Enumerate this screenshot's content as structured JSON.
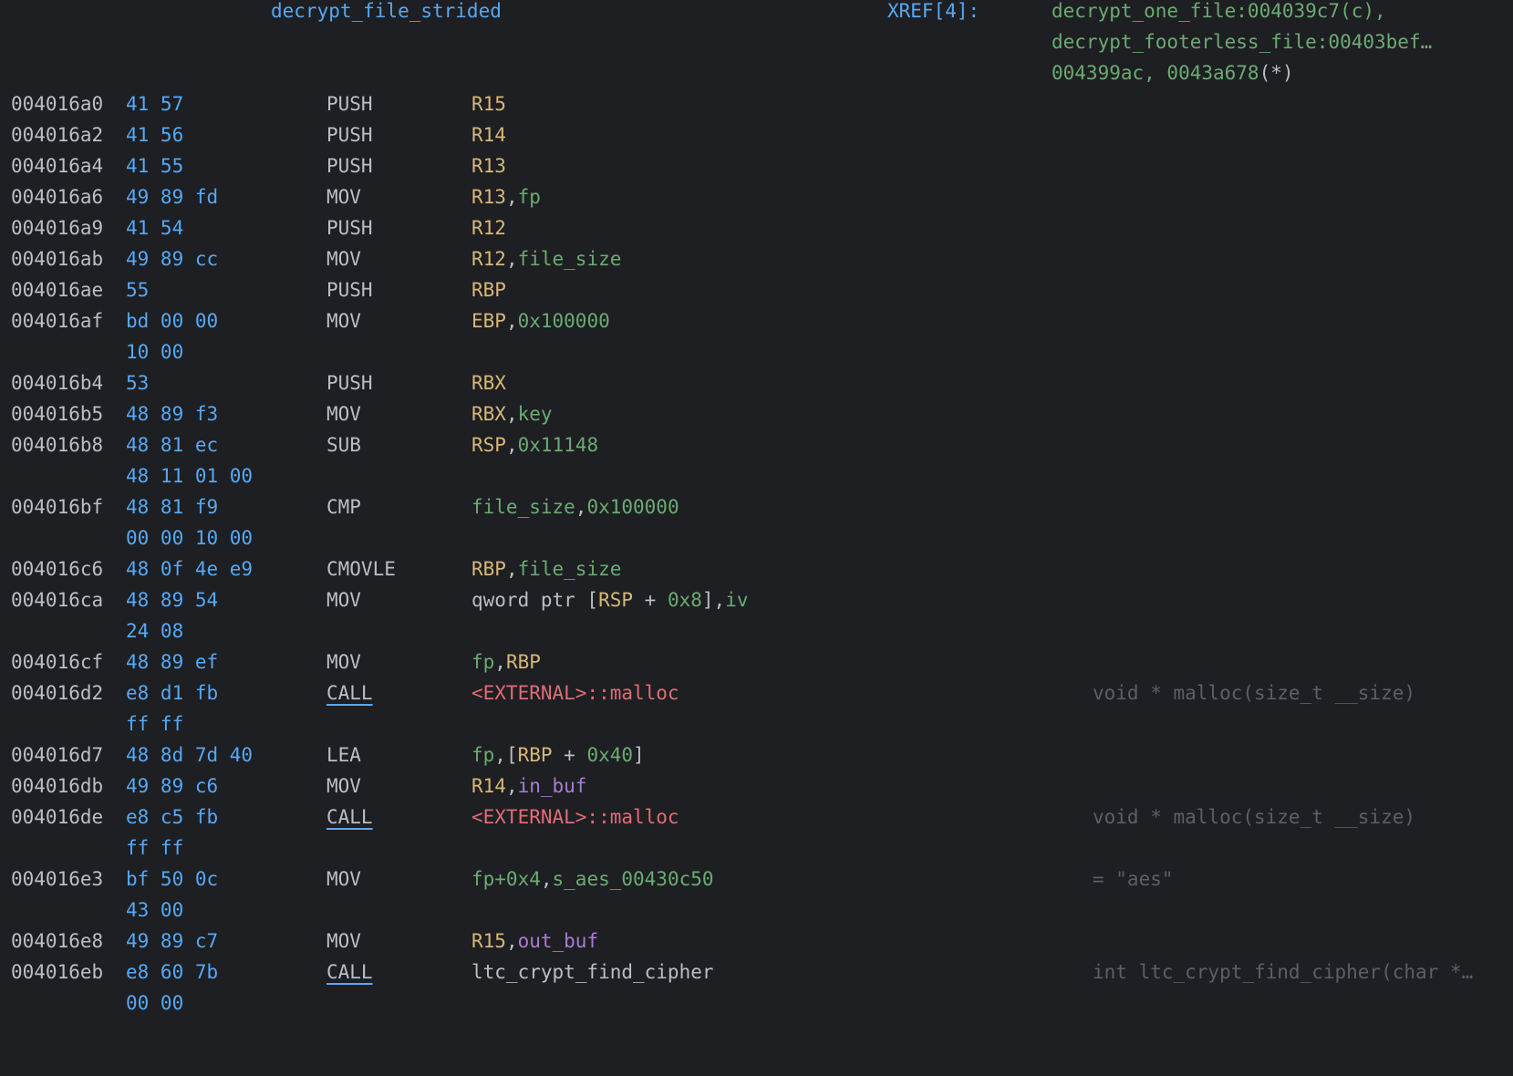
{
  "header": {
    "function_name": "decrypt_file_strided",
    "xref_label": "XREF[4]:",
    "xref_lines": [
      [
        {
          "text": "decrypt_one_file:004039c7(c),",
          "kind": "var"
        }
      ],
      [
        {
          "text": "decrypt_footerless_file:00403bef…",
          "kind": "var"
        }
      ],
      [
        {
          "text": "004399ac, 0043a678",
          "kind": "var"
        },
        {
          "text": "(*)",
          "kind": "plain"
        }
      ]
    ]
  },
  "rows": [
    {
      "addr": "004016a0",
      "bytes": "41 57",
      "mnem": "PUSH",
      "ops": [
        {
          "t": "R15",
          "k": "reg"
        }
      ]
    },
    {
      "addr": "004016a2",
      "bytes": "41 56",
      "mnem": "PUSH",
      "ops": [
        {
          "t": "R14",
          "k": "reg"
        }
      ]
    },
    {
      "addr": "004016a4",
      "bytes": "41 55",
      "mnem": "PUSH",
      "ops": [
        {
          "t": "R13",
          "k": "reg"
        }
      ]
    },
    {
      "addr": "004016a6",
      "bytes": "49 89 fd",
      "mnem": "MOV",
      "ops": [
        {
          "t": "R13",
          "k": "reg"
        },
        {
          "t": ",",
          "k": "plain"
        },
        {
          "t": "fp",
          "k": "var"
        }
      ]
    },
    {
      "addr": "004016a9",
      "bytes": "41 54",
      "mnem": "PUSH",
      "ops": [
        {
          "t": "R12",
          "k": "reg"
        }
      ]
    },
    {
      "addr": "004016ab",
      "bytes": "49 89 cc",
      "mnem": "MOV",
      "ops": [
        {
          "t": "R12",
          "k": "reg"
        },
        {
          "t": ",",
          "k": "plain"
        },
        {
          "t": "file_size",
          "k": "var"
        }
      ]
    },
    {
      "addr": "004016ae",
      "bytes": "55",
      "mnem": "PUSH",
      "ops": [
        {
          "t": "RBP",
          "k": "reg"
        }
      ]
    },
    {
      "addr": "004016af",
      "bytes": "bd 00 00",
      "mnem": "MOV",
      "ops": [
        {
          "t": "EBP",
          "k": "reg"
        },
        {
          "t": ",",
          "k": "plain"
        },
        {
          "t": "0x100000",
          "k": "num"
        }
      ]
    },
    {
      "addr": "",
      "bytes": "10 00",
      "mnem": "",
      "ops": []
    },
    {
      "addr": "004016b4",
      "bytes": "53",
      "mnem": "PUSH",
      "ops": [
        {
          "t": "RBX",
          "k": "reg"
        }
      ]
    },
    {
      "addr": "004016b5",
      "bytes": "48 89 f3",
      "mnem": "MOV",
      "ops": [
        {
          "t": "RBX",
          "k": "reg"
        },
        {
          "t": ",",
          "k": "plain"
        },
        {
          "t": "key",
          "k": "var"
        }
      ]
    },
    {
      "addr": "004016b8",
      "bytes": "48 81 ec",
      "mnem": "SUB",
      "ops": [
        {
          "t": "RSP",
          "k": "reg"
        },
        {
          "t": ",",
          "k": "plain"
        },
        {
          "t": "0x11148",
          "k": "num"
        }
      ]
    },
    {
      "addr": "",
      "bytes": "48 11 01 00",
      "mnem": "",
      "ops": []
    },
    {
      "addr": "004016bf",
      "bytes": "48 81 f9",
      "mnem": "CMP",
      "ops": [
        {
          "t": "file_size",
          "k": "var"
        },
        {
          "t": ",",
          "k": "plain"
        },
        {
          "t": "0x100000",
          "k": "num"
        }
      ]
    },
    {
      "addr": "",
      "bytes": "00 00 10 00",
      "mnem": "",
      "ops": []
    },
    {
      "addr": "004016c6",
      "bytes": "48 0f 4e e9",
      "mnem": "CMOVLE",
      "ops": [
        {
          "t": "RBP",
          "k": "reg"
        },
        {
          "t": ",",
          "k": "plain"
        },
        {
          "t": "file_size",
          "k": "var"
        }
      ]
    },
    {
      "addr": "004016ca",
      "bytes": "48 89 54",
      "mnem": "MOV",
      "ops": [
        {
          "t": "qword ptr [",
          "k": "plain"
        },
        {
          "t": "RSP",
          "k": "reg"
        },
        {
          "t": " + ",
          "k": "plain"
        },
        {
          "t": "0x8",
          "k": "num"
        },
        {
          "t": "],",
          "k": "plain"
        },
        {
          "t": "iv",
          "k": "var"
        }
      ]
    },
    {
      "addr": "",
      "bytes": "24 08",
      "mnem": "",
      "ops": []
    },
    {
      "addr": "004016cf",
      "bytes": "48 89 ef",
      "mnem": "MOV",
      "ops": [
        {
          "t": "fp",
          "k": "var"
        },
        {
          "t": ",",
          "k": "plain"
        },
        {
          "t": "RBP",
          "k": "reg"
        }
      ]
    },
    {
      "addr": "004016d2",
      "bytes": "e8 d1 fb",
      "mnem": "CALL",
      "ops": [
        {
          "t": "<EXTERNAL>::malloc",
          "k": "ext"
        }
      ],
      "comment": "void * malloc(size_t __size)"
    },
    {
      "addr": "",
      "bytes": "ff ff",
      "mnem": "",
      "ops": []
    },
    {
      "addr": "004016d7",
      "bytes": "48 8d 7d 40",
      "mnem": "LEA",
      "ops": [
        {
          "t": "fp",
          "k": "var"
        },
        {
          "t": ",[",
          "k": "plain"
        },
        {
          "t": "RBP",
          "k": "reg"
        },
        {
          "t": " + ",
          "k": "plain"
        },
        {
          "t": "0x40",
          "k": "num"
        },
        {
          "t": "]",
          "k": "plain"
        }
      ]
    },
    {
      "addr": "004016db",
      "bytes": "49 89 c6",
      "mnem": "MOV",
      "ops": [
        {
          "t": "R14",
          "k": "reg"
        },
        {
          "t": ",",
          "k": "plain"
        },
        {
          "t": "in_buf",
          "k": "buf"
        }
      ]
    },
    {
      "addr": "004016de",
      "bytes": "e8 c5 fb",
      "mnem": "CALL",
      "ops": [
        {
          "t": "<EXTERNAL>::malloc",
          "k": "ext"
        }
      ],
      "comment": "void * malloc(size_t __size)"
    },
    {
      "addr": "",
      "bytes": "ff ff",
      "mnem": "",
      "ops": []
    },
    {
      "addr": "004016e3",
      "bytes": "bf 50 0c",
      "mnem": "MOV",
      "ops": [
        {
          "t": "fp+0x4",
          "k": "var"
        },
        {
          "t": ",",
          "k": "plain"
        },
        {
          "t": "s_aes_00430c50",
          "k": "var"
        }
      ],
      "comment": "= \"aes\""
    },
    {
      "addr": "",
      "bytes": "43 00",
      "mnem": "",
      "ops": []
    },
    {
      "addr": "004016e8",
      "bytes": "49 89 c7",
      "mnem": "MOV",
      "ops": [
        {
          "t": "R15",
          "k": "reg"
        },
        {
          "t": ",",
          "k": "plain"
        },
        {
          "t": "out_buf",
          "k": "buf"
        }
      ]
    },
    {
      "addr": "004016eb",
      "bytes": "e8 60 7b",
      "mnem": "CALL",
      "ops": [
        {
          "t": "ltc_crypt_find_cipher",
          "k": "plain"
        }
      ],
      "comment": "int ltc_crypt_find_cipher(char *…"
    },
    {
      "addr": "",
      "bytes": "00 00",
      "mnem": "",
      "ops": []
    }
  ]
}
